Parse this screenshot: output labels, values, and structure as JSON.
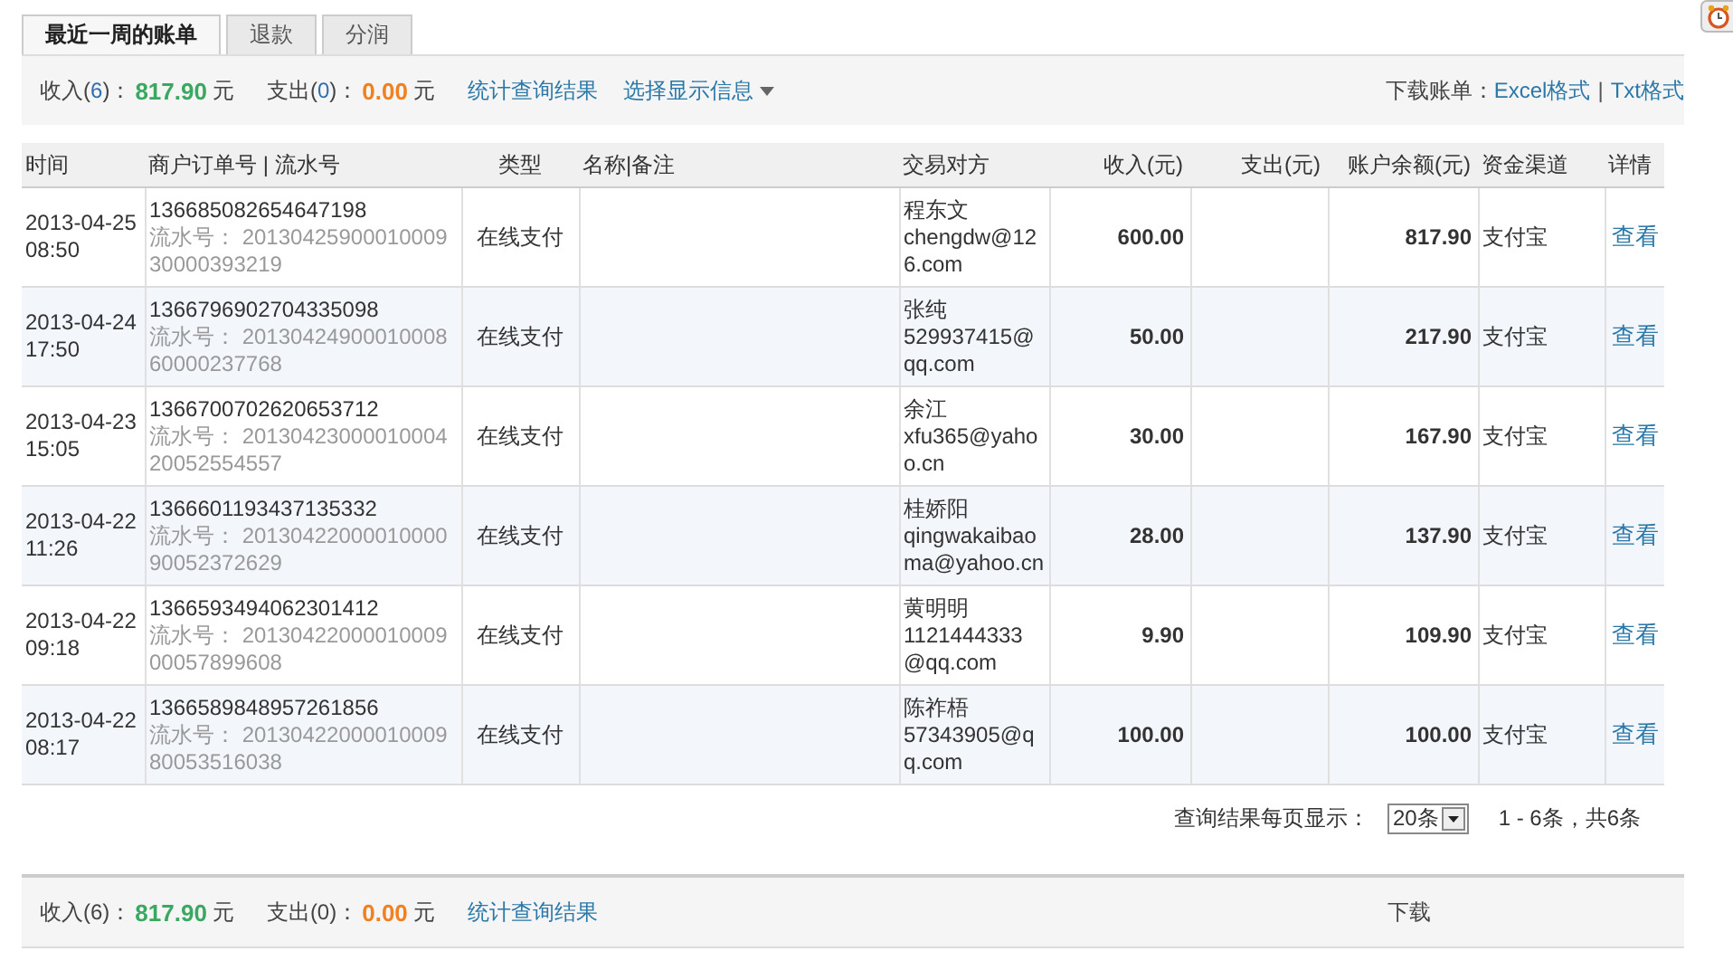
{
  "tabs": [
    {
      "label": "最近一周的账单",
      "selected": true
    },
    {
      "label": "退款",
      "selected": false
    },
    {
      "label": "分润",
      "selected": false
    }
  ],
  "summary": {
    "income_label": "收入(",
    "income_count": "6",
    "income_close": ")：",
    "income_amount": "817.90",
    "income_unit": "元",
    "expense_label": "支出(",
    "expense_count": "0",
    "expense_close": ")：",
    "expense_amount": "0.00",
    "expense_unit": "元",
    "stats_link": "统计查询结果",
    "display_menu": "选择显示信息",
    "download_label": "下载账单：",
    "excel_link": "Excel格式",
    "separator": "|",
    "txt_link": "Txt格式"
  },
  "table": {
    "columns": [
      "时间",
      "商户订单号 | 流水号",
      "类型",
      "名称|备注",
      "交易对方",
      "收入(元)",
      "支出(元)",
      "账户余额(元)",
      "资金渠道",
      "详情"
    ],
    "rows": [
      {
        "date": "2013-04-25",
        "time": "08:50",
        "order_no": "136685082654647198",
        "serial_label": "流水号：",
        "serial": "2013042590001000930000393219",
        "type": "在线支付",
        "party_name": "程东文",
        "party_email": "chengdw@126.com",
        "income": "600.00",
        "balance": "817.90",
        "channel": "支付宝",
        "detail": "查看"
      },
      {
        "date": "2013-04-24",
        "time": "17:50",
        "order_no": "1366796902704335098",
        "serial_label": "流水号：",
        "serial": "2013042490001000860000237768",
        "type": "在线支付",
        "party_name": "张纯",
        "party_email": "529937415@qq.com",
        "income": "50.00",
        "balance": "217.90",
        "channel": "支付宝",
        "detail": "查看"
      },
      {
        "date": "2013-04-23",
        "time": "15:05",
        "order_no": "1366700702620653712",
        "serial_label": "流水号：",
        "serial": "2013042300001000420052554557",
        "type": "在线支付",
        "party_name": "余江",
        "party_email": "xfu365@yahoo.cn",
        "income": "30.00",
        "balance": "167.90",
        "channel": "支付宝",
        "detail": "查看"
      },
      {
        "date": "2013-04-22",
        "time": "11:26",
        "order_no": "1366601193437135332",
        "serial_label": "流水号：",
        "serial": "2013042200001000090052372629",
        "type": "在线支付",
        "party_name": "桂娇阳",
        "party_email": "qingwakaibaoma@yahoo.cn",
        "income": "28.00",
        "balance": "137.90",
        "channel": "支付宝",
        "detail": "查看"
      },
      {
        "date": "2013-04-22",
        "time": "09:18",
        "order_no": "1366593494062301412",
        "serial_label": "流水号：",
        "serial": "2013042200001000900057899608",
        "type": "在线支付",
        "party_name": "黄明明",
        "party_email": "1121444333@qq.com",
        "income": "9.90",
        "balance": "109.90",
        "channel": "支付宝",
        "detail": "查看"
      },
      {
        "date": "2013-04-22",
        "time": "08:17",
        "order_no": "1366589848957261856",
        "serial_label": "流水号：",
        "serial": "2013042200001000980053516038",
        "type": "在线支付",
        "party_name": "陈祚梧",
        "party_email": "57343905@qq.com",
        "income": "100.00",
        "balance": "100.00",
        "channel": "支付宝",
        "detail": "查看"
      }
    ]
  },
  "pagination": {
    "label": "查询结果每页显示：",
    "page_size": "20条",
    "range": "1 - 6条，共6条"
  },
  "footer_summary": {
    "income_label": "收入(6)：",
    "income_amount": "817.90",
    "income_unit": "元",
    "expense_label": "支出(0)：",
    "expense_amount": "0.00",
    "expense_unit": "元",
    "stats_link": "统计查询结果",
    "download_label": "下载"
  }
}
